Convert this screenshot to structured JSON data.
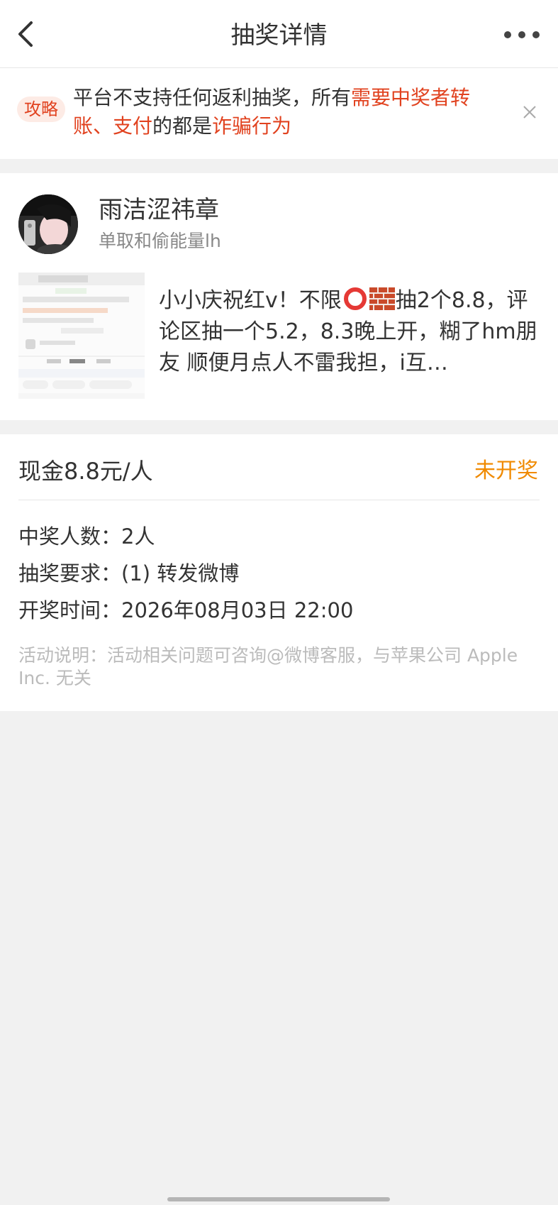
{
  "header": {
    "title": "抽奖详情"
  },
  "notice": {
    "tag": "攻略",
    "part1": "平台不支持任何返利抽奖，所有",
    "part2": "需要中奖者转账、支付",
    "part3": "的都是",
    "part4": "诈骗行为"
  },
  "author": {
    "name": "雨洁涩祎章",
    "subtitle": "单取和偷能量lh"
  },
  "post": {
    "text_before": "小小庆祝红v！不限",
    "text_after": "抽2个8.8，评论区抽一个5.2，8.3晚上开，糊了hm朋友 顺便月点人不雷我担，i互…",
    "emojis": [
      "red-circle-icon",
      "brick-icon"
    ]
  },
  "prize": {
    "amount": "现金8.8元/人",
    "status": "未开奖",
    "winners_label": "中奖人数：",
    "winners_value": "2人",
    "requirement_label": "抽奖要求：",
    "requirement_value": "(1) 转发微博",
    "draw_time_label": "开奖时间：",
    "draw_time_value": "2026年08月03日 22:00",
    "note": "活动说明：活动相关问题可咨询@微博客服，与苹果公司 Apple Inc. 无关"
  },
  "colors": {
    "accent_red": "#e1421f",
    "status_orange": "#f08a00",
    "background": "#f1f1f1"
  }
}
